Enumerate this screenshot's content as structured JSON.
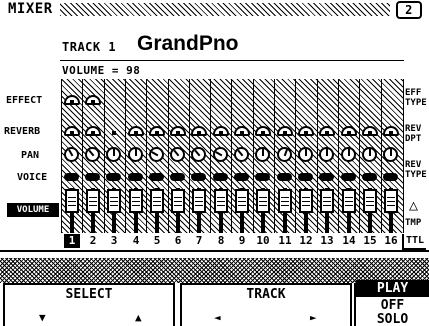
{
  "screen": {
    "title": "MIXER",
    "page_number": "2"
  },
  "track": {
    "label": "TRACK 1",
    "voice_name": "GrandPno",
    "volume_readout": "VOLUME =  98"
  },
  "row_labels": {
    "effect": "EFFECT",
    "reverb": "REVERB",
    "pan": "PAN",
    "voice": "VOICE",
    "volume": "VOLUME"
  },
  "side_labels": {
    "eff_type": "EFF\nTYPE",
    "rev_dpt": "REV\nDPT",
    "rev_type": "REV\nTYPE",
    "tmp": "TMP",
    "ttl": "TTL"
  },
  "channels": [
    {
      "num": "1",
      "effect": true,
      "reverb": "full",
      "active": true
    },
    {
      "num": "2",
      "effect": true,
      "reverb": "full",
      "active": false
    },
    {
      "num": "3",
      "effect": false,
      "reverb": "small",
      "active": false
    },
    {
      "num": "4",
      "effect": false,
      "reverb": "full",
      "active": false
    },
    {
      "num": "5",
      "effect": false,
      "reverb": "full",
      "active": false
    },
    {
      "num": "6",
      "effect": false,
      "reverb": "full",
      "active": false
    },
    {
      "num": "7",
      "effect": false,
      "reverb": "full",
      "active": false
    },
    {
      "num": "8",
      "effect": false,
      "reverb": "full",
      "active": false
    },
    {
      "num": "9",
      "effect": false,
      "reverb": "full",
      "active": false
    },
    {
      "num": "10",
      "effect": false,
      "reverb": "full",
      "active": false
    },
    {
      "num": "11",
      "effect": false,
      "reverb": "full",
      "active": false
    },
    {
      "num": "12",
      "effect": false,
      "reverb": "full",
      "active": false
    },
    {
      "num": "13",
      "effect": false,
      "reverb": "full",
      "active": false
    },
    {
      "num": "14",
      "effect": false,
      "reverb": "full",
      "active": false
    },
    {
      "num": "15",
      "effect": false,
      "reverb": "full",
      "active": false
    },
    {
      "num": "16",
      "effect": false,
      "reverb": "full",
      "active": false
    }
  ],
  "buttons": {
    "select": {
      "label": "SELECT",
      "down": "▼",
      "up": "▲"
    },
    "track": {
      "label": "TRACK",
      "left": "◄",
      "right": "►"
    },
    "play": {
      "label": "PLAY",
      "off": "OFF",
      "solo": "SOLO"
    }
  }
}
